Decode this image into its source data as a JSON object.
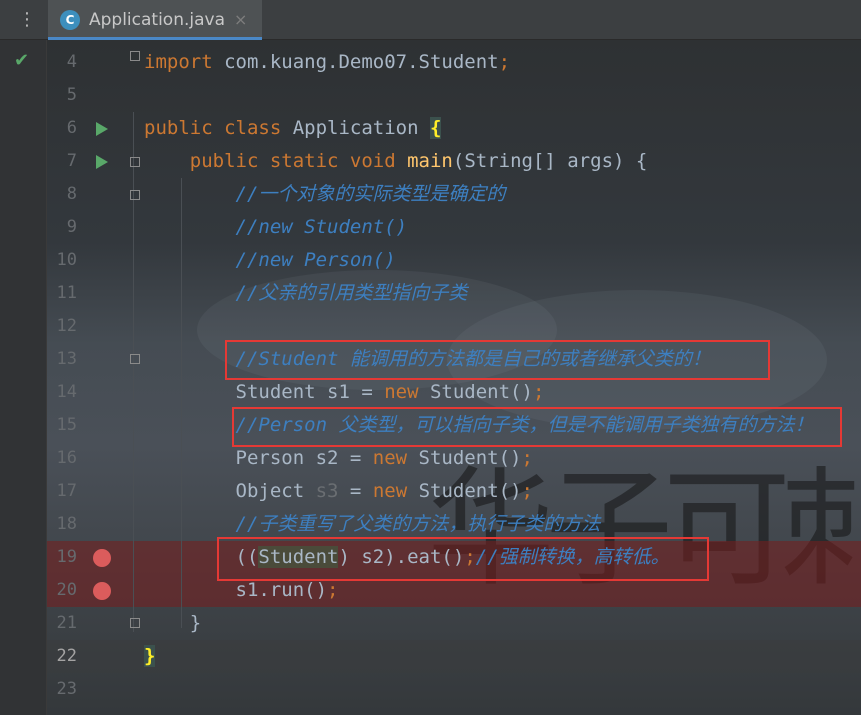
{
  "tab": {
    "icon": "C",
    "title": "Application.java",
    "close": "×"
  },
  "menu_icon": "⋮",
  "check": "✔",
  "watermark": "华子可刺",
  "lines": [
    {
      "n": "4",
      "segments": [
        {
          "t": "import ",
          "c": "kw"
        },
        {
          "t": "com.kuang.Demo07.Student",
          "c": ""
        },
        {
          "t": ";",
          "c": "kw"
        }
      ]
    },
    {
      "n": "5",
      "segments": []
    },
    {
      "n": "6",
      "segments": [
        {
          "t": "public class ",
          "c": "kw"
        },
        {
          "t": "Application ",
          "c": ""
        },
        {
          "t": "{",
          "c": "brace-hl"
        }
      ]
    },
    {
      "n": "7",
      "segments": [
        {
          "t": "    public static void ",
          "c": "kw"
        },
        {
          "t": "main",
          "c": "fn"
        },
        {
          "t": "(String[] args) {",
          "c": ""
        }
      ]
    },
    {
      "n": "8",
      "segments": [
        {
          "t": "        //一个对象的实际类型是确定的",
          "c": "cmb"
        }
      ]
    },
    {
      "n": "9",
      "segments": [
        {
          "t": "        //new Student()",
          "c": "cmb"
        }
      ]
    },
    {
      "n": "10",
      "segments": [
        {
          "t": "        //new Person()",
          "c": "cmb"
        }
      ]
    },
    {
      "n": "11",
      "segments": [
        {
          "t": "        //父亲的引用类型指向子类",
          "c": "cmb"
        }
      ]
    },
    {
      "n": "12",
      "segments": []
    },
    {
      "n": "13",
      "segments": [
        {
          "t": "        //Student 能调用的方法都是自己的或者继承父类的！",
          "c": "cmb"
        }
      ]
    },
    {
      "n": "14",
      "segments": [
        {
          "t": "        Student s1 = ",
          "c": ""
        },
        {
          "t": "new ",
          "c": "kw"
        },
        {
          "t": "Student()",
          "c": ""
        },
        {
          "t": ";",
          "c": "kw"
        }
      ]
    },
    {
      "n": "15",
      "segments": [
        {
          "t": "        //Person 父类型，可以指向子类，但是不能调用子类独有的方法！",
          "c": "cmb"
        }
      ]
    },
    {
      "n": "16",
      "segments": [
        {
          "t": "        Person s2 = ",
          "c": ""
        },
        {
          "t": "new ",
          "c": "kw"
        },
        {
          "t": "Student()",
          "c": ""
        },
        {
          "t": ";",
          "c": "kw"
        }
      ]
    },
    {
      "n": "17",
      "segments": [
        {
          "t": "        Object ",
          "c": ""
        },
        {
          "t": "s3",
          "c": "dim"
        },
        {
          "t": " = ",
          "c": ""
        },
        {
          "t": "new ",
          "c": "kw"
        },
        {
          "t": "Student()",
          "c": ""
        },
        {
          "t": ";",
          "c": "kw"
        }
      ]
    },
    {
      "n": "18",
      "segments": [
        {
          "t": "        //子类重写了父类的方法，执行子类的方法",
          "c": "cmb"
        }
      ]
    },
    {
      "n": "19",
      "segments": [
        {
          "t": "        ((",
          "c": ""
        },
        {
          "t": "Student",
          "c": "ident-hl"
        },
        {
          "t": ") s2).eat()",
          "c": ""
        },
        {
          "t": ";",
          "c": "kw"
        },
        {
          "t": "//强制转换，高转低。",
          "c": "cmb"
        }
      ]
    },
    {
      "n": "20",
      "segments": [
        {
          "t": "        s1.run()",
          "c": ""
        },
        {
          "t": ";",
          "c": "kw"
        }
      ]
    },
    {
      "n": "21",
      "segments": [
        {
          "t": "    }",
          "c": ""
        }
      ]
    },
    {
      "n": "22",
      "segments": [
        {
          "t": "}",
          "c": "brace-hl"
        }
      ]
    },
    {
      "n": "23",
      "segments": []
    }
  ]
}
